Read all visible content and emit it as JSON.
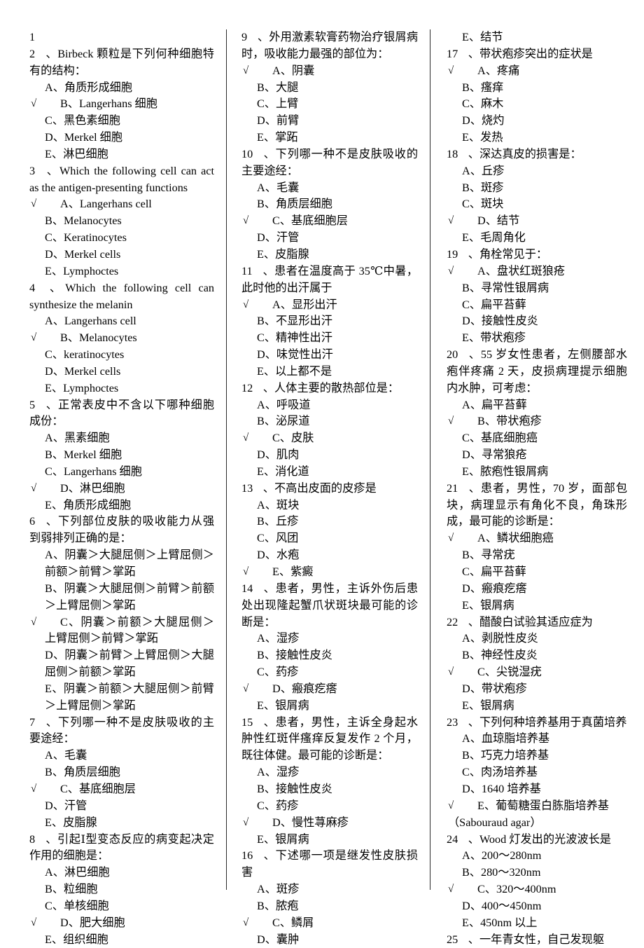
{
  "document": {
    "type": "exam-question-paper",
    "subject_hint": "皮肤科 多项选择题",
    "columns": 3,
    "tick_glyph": "√"
  },
  "columns": [
    {
      "id": "column-1",
      "blocks": [
        {
          "kind": "stem",
          "num": "1",
          "sep": "",
          "text": ""
        },
        {
          "kind": "stem",
          "num": "2",
          "sep": "、",
          "text": "Birbeck 颗粒是下列何种细胞特有的结构："
        },
        {
          "kind": "option",
          "correct": false,
          "label": "A、",
          "text": "角质形成细胞"
        },
        {
          "kind": "option",
          "correct": true,
          "label": "B、",
          "text": "Langerhans 细胞"
        },
        {
          "kind": "option",
          "correct": false,
          "label": "C、",
          "text": "黑色素细胞"
        },
        {
          "kind": "option",
          "correct": false,
          "label": "D、",
          "text": "Merkel 细胞"
        },
        {
          "kind": "option",
          "correct": false,
          "label": "E、",
          "text": "淋巴细胞"
        },
        {
          "kind": "stem",
          "num": "3",
          "sep": "、",
          "text": "Which the following cell can act as the antigen-presenting functions"
        },
        {
          "kind": "option",
          "correct": true,
          "label": "A、",
          "text": "Langerhans cell"
        },
        {
          "kind": "option",
          "correct": false,
          "label": "B、",
          "text": "Melanocytes"
        },
        {
          "kind": "option",
          "correct": false,
          "label": "C、",
          "text": "Keratinocytes"
        },
        {
          "kind": "option",
          "correct": false,
          "label": "D、",
          "text": "Merkel cells"
        },
        {
          "kind": "option",
          "correct": false,
          "label": "E、",
          "text": "Lymphoctes"
        },
        {
          "kind": "stem",
          "num": "4",
          "sep": "、",
          "text": "Which the following cell can synthesize the melanin"
        },
        {
          "kind": "option",
          "correct": false,
          "label": "A、",
          "text": "Langerhans cell"
        },
        {
          "kind": "option",
          "correct": true,
          "label": "B、",
          "text": "Melanocytes"
        },
        {
          "kind": "option",
          "correct": false,
          "label": "C、",
          "text": "keratinocytes"
        },
        {
          "kind": "option",
          "correct": false,
          "label": "D、",
          "text": "Merkel cells"
        },
        {
          "kind": "option",
          "correct": false,
          "label": "E、",
          "text": "Lymphoctes"
        },
        {
          "kind": "stem",
          "num": "5",
          "sep": "、",
          "text": "正常表皮中不含以下哪种细胞成份："
        },
        {
          "kind": "option",
          "correct": false,
          "label": "A、",
          "text": "黑素细胞"
        },
        {
          "kind": "option",
          "correct": false,
          "label": "B、",
          "text": "Merkel 细胞"
        },
        {
          "kind": "option",
          "correct": false,
          "label": "C、",
          "text": "Langerhans 细胞"
        },
        {
          "kind": "option",
          "correct": true,
          "label": "D、",
          "text": "淋巴细胞"
        },
        {
          "kind": "option",
          "correct": false,
          "label": "E、",
          "text": "角质形成细胞"
        },
        {
          "kind": "stem",
          "num": "6",
          "sep": "、",
          "text": "下列部位皮肤的吸收能力从强到弱排列正确的是："
        },
        {
          "kind": "option",
          "correct": false,
          "label": "A、",
          "text": "阴囊＞大腿屈侧＞上臂屈侧＞前额＞前臂＞掌跖"
        },
        {
          "kind": "option",
          "correct": false,
          "label": "B、",
          "text": "阴囊＞大腿屈侧＞前臂＞前额＞上臂屈侧＞掌跖"
        },
        {
          "kind": "option",
          "correct": true,
          "label": "C、",
          "text": "阴囊＞前额＞大腿屈侧＞上臂屈侧＞前臂＞掌跖"
        },
        {
          "kind": "option",
          "correct": false,
          "label": "D、",
          "text": "阴囊＞前臂＞上臂屈侧＞大腿屈侧＞前额＞掌跖"
        },
        {
          "kind": "option",
          "correct": false,
          "label": "E、",
          "text": "阴囊＞前额＞大腿屈侧＞前臂＞上臂屈侧＞掌跖"
        },
        {
          "kind": "stem",
          "num": "7",
          "sep": "、",
          "text": "下列哪一种不是皮肤吸收的主要途经："
        },
        {
          "kind": "option",
          "correct": false,
          "label": "A、",
          "text": "毛囊"
        },
        {
          "kind": "option",
          "correct": false,
          "label": "B、",
          "text": "角质层细胞"
        },
        {
          "kind": "option",
          "correct": true,
          "label": "C、",
          "text": "基底细胞层"
        },
        {
          "kind": "option",
          "correct": false,
          "label": "D、",
          "text": "汗管"
        },
        {
          "kind": "option",
          "correct": false,
          "label": "E、",
          "text": "皮脂腺"
        },
        {
          "kind": "stem",
          "num": "8",
          "sep": "、",
          "text": "引起Ⅰ型变态反应的病变起决定作用的细胞是："
        },
        {
          "kind": "option",
          "correct": false,
          "label": "A、",
          "text": "淋巴细胞"
        },
        {
          "kind": "option",
          "correct": false,
          "label": "B、",
          "text": "粒细胞"
        },
        {
          "kind": "option",
          "correct": false,
          "label": "C、",
          "text": "单核细胞"
        },
        {
          "kind": "option",
          "correct": true,
          "label": "D、",
          "text": "肥大细胞"
        },
        {
          "kind": "option",
          "correct": false,
          "label": "E、",
          "text": "组织细胞"
        }
      ]
    },
    {
      "id": "column-2",
      "blocks": [
        {
          "kind": "stem",
          "num": "9",
          "sep": "、",
          "text": "外用激素软膏药物治疗银屑病时，吸收能力最强的部位为："
        },
        {
          "kind": "option",
          "correct": true,
          "label": "A、",
          "text": "阴囊"
        },
        {
          "kind": "option",
          "correct": false,
          "label": "B、",
          "text": "大腿"
        },
        {
          "kind": "option",
          "correct": false,
          "label": "C、",
          "text": "上臂"
        },
        {
          "kind": "option",
          "correct": false,
          "label": "D、",
          "text": "前臂"
        },
        {
          "kind": "option",
          "correct": false,
          "label": "E、",
          "text": "掌跖"
        },
        {
          "kind": "stem",
          "num": "10",
          "sep": "、",
          "text": "下列哪一种不是皮肤吸收的主要途经："
        },
        {
          "kind": "option",
          "correct": false,
          "label": "A、",
          "text": "毛囊"
        },
        {
          "kind": "option",
          "correct": false,
          "label": "B、",
          "text": "角质层细胞"
        },
        {
          "kind": "option",
          "correct": true,
          "label": "C、",
          "text": "基底细胞层"
        },
        {
          "kind": "option",
          "correct": false,
          "label": "D、",
          "text": "汗管"
        },
        {
          "kind": "option",
          "correct": false,
          "label": "E、",
          "text": "皮脂腺"
        },
        {
          "kind": "stem",
          "num": "11",
          "sep": "、",
          "text": "患者在温度高于 35℃中暑，此时他的出汗属于"
        },
        {
          "kind": "option",
          "correct": true,
          "label": "A、",
          "text": "显形出汗"
        },
        {
          "kind": "option",
          "correct": false,
          "label": "B、",
          "text": "不显形出汗"
        },
        {
          "kind": "option",
          "correct": false,
          "label": "C、",
          "text": "精神性出汗"
        },
        {
          "kind": "option",
          "correct": false,
          "label": "D、",
          "text": "味觉性出汗"
        },
        {
          "kind": "option",
          "correct": false,
          "label": "E、",
          "text": "以上都不是"
        },
        {
          "kind": "stem",
          "num": "12",
          "sep": "、",
          "text": "人体主要的散热部位是："
        },
        {
          "kind": "option",
          "correct": false,
          "label": "A、",
          "text": "呼吸道"
        },
        {
          "kind": "option",
          "correct": false,
          "label": "B、",
          "text": "泌尿道"
        },
        {
          "kind": "option",
          "correct": true,
          "label": "C、",
          "text": "皮肤"
        },
        {
          "kind": "option",
          "correct": false,
          "label": "D、",
          "text": "肌肉"
        },
        {
          "kind": "option",
          "correct": false,
          "label": "E、",
          "text": "消化道"
        },
        {
          "kind": "stem",
          "num": "13",
          "sep": "、",
          "text": "不高出皮面的皮疹是"
        },
        {
          "kind": "option",
          "correct": false,
          "label": "A、",
          "text": "斑块"
        },
        {
          "kind": "option",
          "correct": false,
          "label": "B、",
          "text": "丘疹"
        },
        {
          "kind": "option",
          "correct": false,
          "label": "C、",
          "text": "风团"
        },
        {
          "kind": "option",
          "correct": false,
          "label": "D、",
          "text": "水疱"
        },
        {
          "kind": "option",
          "correct": true,
          "label": "E、",
          "text": "紫癜"
        },
        {
          "kind": "stem",
          "num": "14",
          "sep": "、",
          "text": "患者，男性，主诉外伤后患处出现隆起蟹爪状斑块最可能的诊断是："
        },
        {
          "kind": "option",
          "correct": false,
          "label": "A、",
          "text": "湿疹"
        },
        {
          "kind": "option",
          "correct": false,
          "label": "B、",
          "text": "接触性皮炎"
        },
        {
          "kind": "option",
          "correct": false,
          "label": "C、",
          "text": "药疹"
        },
        {
          "kind": "option",
          "correct": true,
          "label": "D、",
          "text": "瘢痕疙瘩"
        },
        {
          "kind": "option",
          "correct": false,
          "label": "E、",
          "text": "银屑病"
        },
        {
          "kind": "stem",
          "num": "15",
          "sep": "、",
          "text": "患者，男性，主诉全身起水肿性红斑伴瘙痒反复发作 2 个月，既往体健。最可能的诊断是："
        },
        {
          "kind": "option",
          "correct": false,
          "label": "A、",
          "text": "湿疹"
        },
        {
          "kind": "option",
          "correct": false,
          "label": "B、",
          "text": "接触性皮炎"
        },
        {
          "kind": "option",
          "correct": false,
          "label": "C、",
          "text": "药疹"
        },
        {
          "kind": "option",
          "correct": true,
          "label": "D、",
          "text": "慢性荨麻疹"
        },
        {
          "kind": "option",
          "correct": false,
          "label": "E、",
          "text": "银屑病"
        },
        {
          "kind": "stem",
          "num": "16",
          "sep": "、",
          "text": "下述哪一项是继发性皮肤损害"
        },
        {
          "kind": "option",
          "correct": false,
          "label": "A、",
          "text": "斑疹"
        },
        {
          "kind": "option",
          "correct": false,
          "label": "B、",
          "text": "脓疱"
        },
        {
          "kind": "option",
          "correct": true,
          "label": "C、",
          "text": "鳞屑"
        },
        {
          "kind": "option",
          "correct": false,
          "label": "D、",
          "text": "囊肿"
        }
      ]
    },
    {
      "id": "column-3",
      "blocks": [
        {
          "kind": "option",
          "correct": false,
          "label": "E、",
          "text": "结节"
        },
        {
          "kind": "stem",
          "num": "17",
          "sep": "、",
          "text": "带状疱疹突出的症状是"
        },
        {
          "kind": "option",
          "correct": true,
          "label": "A、",
          "text": "疼痛"
        },
        {
          "kind": "option",
          "correct": false,
          "label": "B、",
          "text": "瘙痒"
        },
        {
          "kind": "option",
          "correct": false,
          "label": "C、",
          "text": "麻木"
        },
        {
          "kind": "option",
          "correct": false,
          "label": "D、",
          "text": "烧灼"
        },
        {
          "kind": "option",
          "correct": false,
          "label": "E、",
          "text": "发热"
        },
        {
          "kind": "stem",
          "num": "18",
          "sep": "、",
          "text": "深达真皮的损害是："
        },
        {
          "kind": "option",
          "correct": false,
          "label": "A、",
          "text": "丘疹"
        },
        {
          "kind": "option",
          "correct": false,
          "label": "B、",
          "text": "斑疹"
        },
        {
          "kind": "option",
          "correct": false,
          "label": "C、",
          "text": "斑块"
        },
        {
          "kind": "option",
          "correct": true,
          "label": "D、",
          "text": "结节"
        },
        {
          "kind": "option",
          "correct": false,
          "label": "E、",
          "text": "毛周角化"
        },
        {
          "kind": "stem",
          "num": "19",
          "sep": "、",
          "text": "角栓常见于："
        },
        {
          "kind": "option",
          "correct": true,
          "label": "A、",
          "text": "盘状红斑狼疮"
        },
        {
          "kind": "option",
          "correct": false,
          "label": "B、",
          "text": "寻常性银屑病"
        },
        {
          "kind": "option",
          "correct": false,
          "label": "C、",
          "text": "扁平苔藓"
        },
        {
          "kind": "option",
          "correct": false,
          "label": "D、",
          "text": "接触性皮炎"
        },
        {
          "kind": "option",
          "correct": false,
          "label": "E、",
          "text": "带状疱疹"
        },
        {
          "kind": "stem",
          "num": "20",
          "sep": "、",
          "text": "55 岁女性患者，左侧腰部水疱伴疼痛 2 天，皮损病理提示细胞内水肿，可考虑："
        },
        {
          "kind": "option",
          "correct": false,
          "label": "A、",
          "text": "扁平苔藓"
        },
        {
          "kind": "option",
          "correct": true,
          "label": "B、",
          "text": "带状疱疹"
        },
        {
          "kind": "option",
          "correct": false,
          "label": "C、",
          "text": "基底细胞癌"
        },
        {
          "kind": "option",
          "correct": false,
          "label": "D、",
          "text": "寻常狼疮"
        },
        {
          "kind": "option",
          "correct": false,
          "label": "E、",
          "text": "脓疱性银屑病"
        },
        {
          "kind": "stem",
          "num": "21",
          "sep": "、",
          "text": "患者，男性，70 岁，面部包块，病理显示有角化不良，角珠形成，最可能的诊断是："
        },
        {
          "kind": "option",
          "correct": true,
          "label": "A、",
          "text": "鳞状细胞癌"
        },
        {
          "kind": "option",
          "correct": false,
          "label": "B、",
          "text": "寻常疣"
        },
        {
          "kind": "option",
          "correct": false,
          "label": "C、",
          "text": "扁平苔藓"
        },
        {
          "kind": "option",
          "correct": false,
          "label": "D、",
          "text": "瘢痕疙瘩"
        },
        {
          "kind": "option",
          "correct": false,
          "label": "E、",
          "text": "银屑病"
        },
        {
          "kind": "stem",
          "num": "22",
          "sep": "、",
          "text": "醋酸白试验其适应症为"
        },
        {
          "kind": "option",
          "correct": false,
          "label": "A、",
          "text": "剥脱性皮炎"
        },
        {
          "kind": "option",
          "correct": false,
          "label": "B、",
          "text": "神经性皮炎"
        },
        {
          "kind": "option",
          "correct": true,
          "label": "C、",
          "text": "尖锐湿疣"
        },
        {
          "kind": "option",
          "correct": false,
          "label": "D、",
          "text": "带状疱疹"
        },
        {
          "kind": "option",
          "correct": false,
          "label": "E、",
          "text": "银屑病"
        },
        {
          "kind": "stem",
          "num": "23",
          "sep": "、",
          "text": "下列何种培养基用于真菌培养"
        },
        {
          "kind": "option",
          "correct": false,
          "label": "A、",
          "text": "血琼脂培养基"
        },
        {
          "kind": "option",
          "correct": false,
          "label": "B、",
          "text": "巧克力培养基"
        },
        {
          "kind": "option",
          "correct": false,
          "label": "C、",
          "text": "肉汤培养基"
        },
        {
          "kind": "option",
          "correct": false,
          "label": "D、",
          "text": "1640 培养基"
        },
        {
          "kind": "option",
          "correct": true,
          "label": "E、",
          "text": "葡萄糖蛋白胨脂培养基"
        },
        {
          "kind": "note",
          "text": "（Sabouraud agar）"
        },
        {
          "kind": "stem",
          "num": "24",
          "sep": "、",
          "text": "Wood 灯发出的光波波长是"
        },
        {
          "kind": "option",
          "correct": false,
          "label": "A、",
          "text": "200～280nm"
        },
        {
          "kind": "option",
          "correct": false,
          "label": "B、",
          "text": "280～320nm"
        },
        {
          "kind": "option",
          "correct": true,
          "label": "C、",
          "text": "320～400nm"
        },
        {
          "kind": "option",
          "correct": false,
          "label": "D、",
          "text": "400～450nm"
        },
        {
          "kind": "option",
          "correct": false,
          "label": "E、",
          "text": "450nm 以上"
        },
        {
          "kind": "stem",
          "num": "25",
          "sep": "、",
          "text": "一年青女性，自己发现躯"
        }
      ]
    }
  ]
}
